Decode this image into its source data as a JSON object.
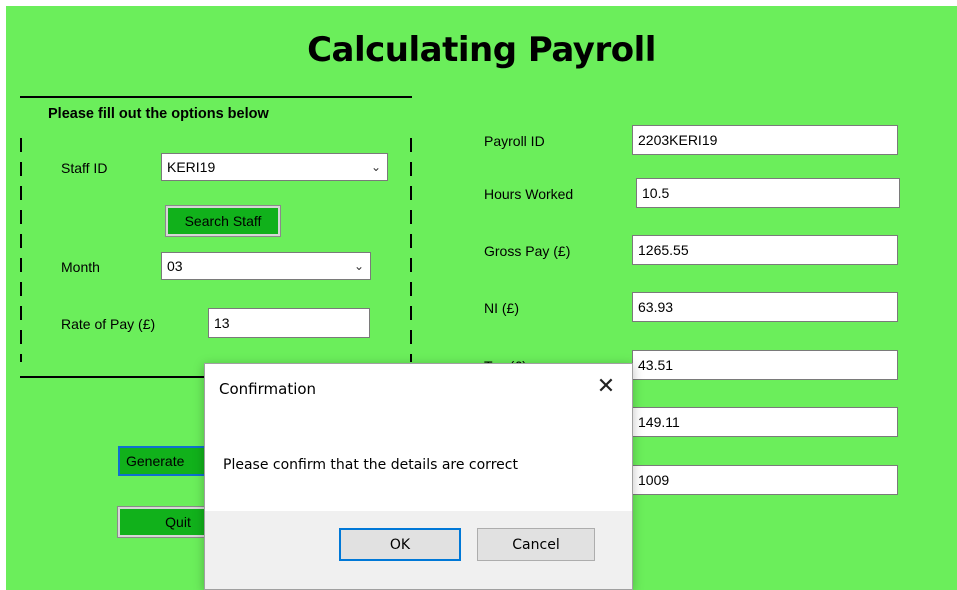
{
  "form": {
    "title": "Calculating Payroll",
    "options_group": {
      "title": "Please fill out the options below",
      "staff_id_label": "Staff ID",
      "staff_id_value": "KERI19",
      "search_staff_label": "Search Staff",
      "month_label": "Month",
      "month_value": "03",
      "rate_label": "Rate of Pay (£)",
      "rate_value": "13"
    },
    "results": [
      {
        "label": "Payroll ID",
        "value": "2203KERI19"
      },
      {
        "label": "Hours Worked",
        "value": "10.5"
      },
      {
        "label": "Gross Pay (£)",
        "value": "1265.55"
      },
      {
        "label": "NI (£)",
        "value": "63.93"
      },
      {
        "label": "Tax (£)",
        "value": "43.51"
      },
      {
        "label": "",
        "value": "149.11"
      },
      {
        "label": "",
        "value": "1009"
      }
    ],
    "generate_label": "Generate",
    "quit_label": "Quit"
  },
  "dialog": {
    "title": "Confirmation",
    "close_glyph": "✕",
    "message": "Please confirm that the details are correct",
    "ok_label": "OK",
    "cancel_label": "Cancel"
  },
  "colors": {
    "form_background": "#6bee5b",
    "button_green": "#11b11b",
    "focus_blue": "#0078d7"
  }
}
